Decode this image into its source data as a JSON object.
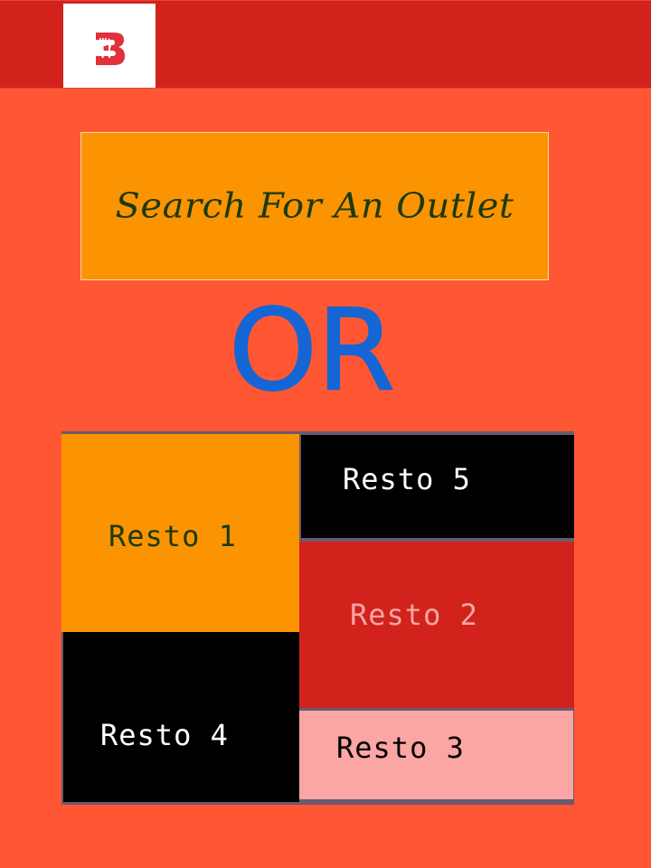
{
  "header": {
    "logo_icon": "restaurant-logo-icon",
    "brand_color": "#d1221b"
  },
  "search": {
    "label": "Search For An Outlet",
    "background": "#fb9400"
  },
  "divider_text": "OR",
  "restaurants": [
    {
      "label": "Resto 1",
      "color": "#fb9400"
    },
    {
      "label": "Resto 5",
      "color": "#000000"
    },
    {
      "label": "Resto 2",
      "color": "#d1221b"
    },
    {
      "label": "Resto 4",
      "color": "#000000"
    },
    {
      "label": "Resto 3",
      "color": "#fca5a5"
    }
  ]
}
